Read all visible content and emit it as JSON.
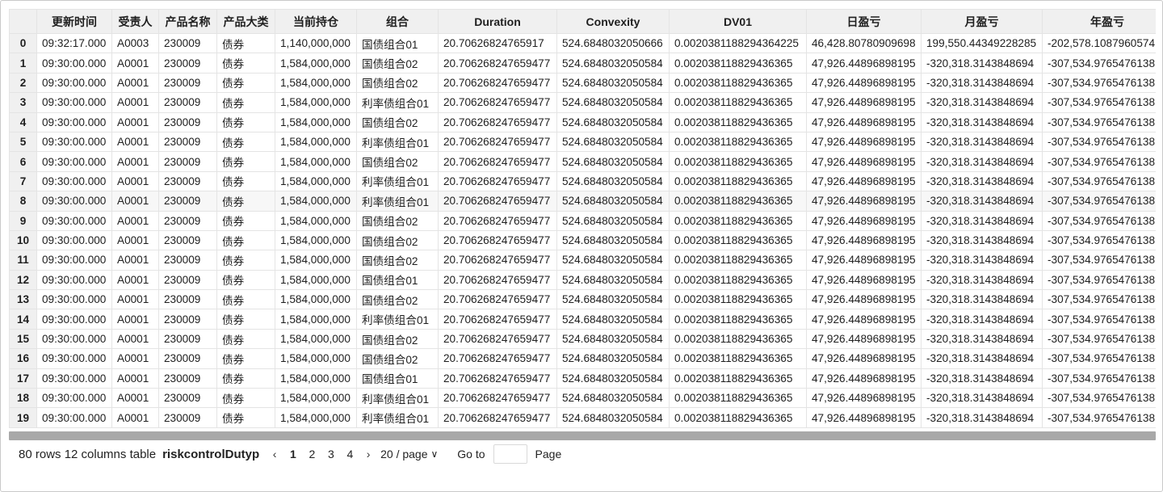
{
  "table": {
    "columns": [
      "",
      "更新时间",
      "受责人",
      "产品名称",
      "产品大类",
      "当前持仓",
      "组合",
      "Duration",
      "Convexity",
      "DV01",
      "日盈亏",
      "月盈亏",
      "年盈亏"
    ],
    "rows": [
      [
        "0",
        "09:32:17.000",
        "A0003",
        "230009",
        "债券",
        "1,140,000,000",
        "国债组合01",
        "20.70626824765917",
        "524.6848032050666",
        "0.0020381188294364225",
        "46,428.80780909698",
        "199,550.44349228285",
        "-202,578.1087960574"
      ],
      [
        "1",
        "09:30:00.000",
        "A0001",
        "230009",
        "债券",
        "1,584,000,000",
        "国债组合02",
        "20.706268247659477",
        "524.6848032050584",
        "0.002038118829436365",
        "47,926.44896898195",
        "-320,318.3143848694",
        "-307,534.9765476138"
      ],
      [
        "2",
        "09:30:00.000",
        "A0001",
        "230009",
        "债券",
        "1,584,000,000",
        "国债组合02",
        "20.706268247659477",
        "524.6848032050584",
        "0.002038118829436365",
        "47,926.44896898195",
        "-320,318.3143848694",
        "-307,534.9765476138"
      ],
      [
        "3",
        "09:30:00.000",
        "A0001",
        "230009",
        "债券",
        "1,584,000,000",
        "利率债组合01",
        "20.706268247659477",
        "524.6848032050584",
        "0.002038118829436365",
        "47,926.44896898195",
        "-320,318.3143848694",
        "-307,534.9765476138"
      ],
      [
        "4",
        "09:30:00.000",
        "A0001",
        "230009",
        "债券",
        "1,584,000,000",
        "国债组合02",
        "20.706268247659477",
        "524.6848032050584",
        "0.002038118829436365",
        "47,926.44896898195",
        "-320,318.3143848694",
        "-307,534.9765476138"
      ],
      [
        "5",
        "09:30:00.000",
        "A0001",
        "230009",
        "债券",
        "1,584,000,000",
        "利率债组合01",
        "20.706268247659477",
        "524.6848032050584",
        "0.002038118829436365",
        "47,926.44896898195",
        "-320,318.3143848694",
        "-307,534.9765476138"
      ],
      [
        "6",
        "09:30:00.000",
        "A0001",
        "230009",
        "债券",
        "1,584,000,000",
        "国债组合02",
        "20.706268247659477",
        "524.6848032050584",
        "0.002038118829436365",
        "47,926.44896898195",
        "-320,318.3143848694",
        "-307,534.9765476138"
      ],
      [
        "7",
        "09:30:00.000",
        "A0001",
        "230009",
        "债券",
        "1,584,000,000",
        "利率债组合01",
        "20.706268247659477",
        "524.6848032050584",
        "0.002038118829436365",
        "47,926.44896898195",
        "-320,318.3143848694",
        "-307,534.9765476138"
      ],
      [
        "8",
        "09:30:00.000",
        "A0001",
        "230009",
        "债券",
        "1,584,000,000",
        "利率债组合01",
        "20.706268247659477",
        "524.6848032050584",
        "0.002038118829436365",
        "47,926.44896898195",
        "-320,318.3143848694",
        "-307,534.9765476138"
      ],
      [
        "9",
        "09:30:00.000",
        "A0001",
        "230009",
        "债券",
        "1,584,000,000",
        "国债组合02",
        "20.706268247659477",
        "524.6848032050584",
        "0.002038118829436365",
        "47,926.44896898195",
        "-320,318.3143848694",
        "-307,534.9765476138"
      ],
      [
        "10",
        "09:30:00.000",
        "A0001",
        "230009",
        "债券",
        "1,584,000,000",
        "国债组合02",
        "20.706268247659477",
        "524.6848032050584",
        "0.002038118829436365",
        "47,926.44896898195",
        "-320,318.3143848694",
        "-307,534.9765476138"
      ],
      [
        "11",
        "09:30:00.000",
        "A0001",
        "230009",
        "债券",
        "1,584,000,000",
        "国债组合02",
        "20.706268247659477",
        "524.6848032050584",
        "0.002038118829436365",
        "47,926.44896898195",
        "-320,318.3143848694",
        "-307,534.9765476138"
      ],
      [
        "12",
        "09:30:00.000",
        "A0001",
        "230009",
        "债券",
        "1,584,000,000",
        "国债组合01",
        "20.706268247659477",
        "524.6848032050584",
        "0.002038118829436365",
        "47,926.44896898195",
        "-320,318.3143848694",
        "-307,534.9765476138"
      ],
      [
        "13",
        "09:30:00.000",
        "A0001",
        "230009",
        "债券",
        "1,584,000,000",
        "国债组合02",
        "20.706268247659477",
        "524.6848032050584",
        "0.002038118829436365",
        "47,926.44896898195",
        "-320,318.3143848694",
        "-307,534.9765476138"
      ],
      [
        "14",
        "09:30:00.000",
        "A0001",
        "230009",
        "债券",
        "1,584,000,000",
        "利率债组合01",
        "20.706268247659477",
        "524.6848032050584",
        "0.002038118829436365",
        "47,926.44896898195",
        "-320,318.3143848694",
        "-307,534.9765476138"
      ],
      [
        "15",
        "09:30:00.000",
        "A0001",
        "230009",
        "债券",
        "1,584,000,000",
        "国债组合02",
        "20.706268247659477",
        "524.6848032050584",
        "0.002038118829436365",
        "47,926.44896898195",
        "-320,318.3143848694",
        "-307,534.9765476138"
      ],
      [
        "16",
        "09:30:00.000",
        "A0001",
        "230009",
        "债券",
        "1,584,000,000",
        "国债组合02",
        "20.706268247659477",
        "524.6848032050584",
        "0.002038118829436365",
        "47,926.44896898195",
        "-320,318.3143848694",
        "-307,534.9765476138"
      ],
      [
        "17",
        "09:30:00.000",
        "A0001",
        "230009",
        "债券",
        "1,584,000,000",
        "国债组合01",
        "20.706268247659477",
        "524.6848032050584",
        "0.002038118829436365",
        "47,926.44896898195",
        "-320,318.3143848694",
        "-307,534.9765476138"
      ],
      [
        "18",
        "09:30:00.000",
        "A0001",
        "230009",
        "债券",
        "1,584,000,000",
        "利率债组合01",
        "20.706268247659477",
        "524.6848032050584",
        "0.002038118829436365",
        "47,926.44896898195",
        "-320,318.3143848694",
        "-307,534.9765476138"
      ],
      [
        "19",
        "09:30:00.000",
        "A0001",
        "230009",
        "债券",
        "1,584,000,000",
        "利率债组合01",
        "20.706268247659477",
        "524.6848032050584",
        "0.002038118829436365",
        "47,926.44896898195",
        "-320,318.3143848694",
        "-307,534.9765476138"
      ]
    ]
  },
  "footer": {
    "info": "80 rows 12 columns table",
    "table_name": "riskcontrolDutyp",
    "prev_icon": "chevron-left-icon",
    "next_icon": "chevron-right-icon",
    "pages": [
      "1",
      "2",
      "3",
      "4"
    ],
    "current_page": "1",
    "page_size": "20 / page",
    "page_size_icon": "chevron-down-icon",
    "goto_label": "Go to",
    "goto_value": "",
    "page_label": "Page"
  },
  "colors": {
    "header_bg": "#f0f0f0",
    "border": "#e4e4e4",
    "scrollbar": "#a8a8a8"
  }
}
